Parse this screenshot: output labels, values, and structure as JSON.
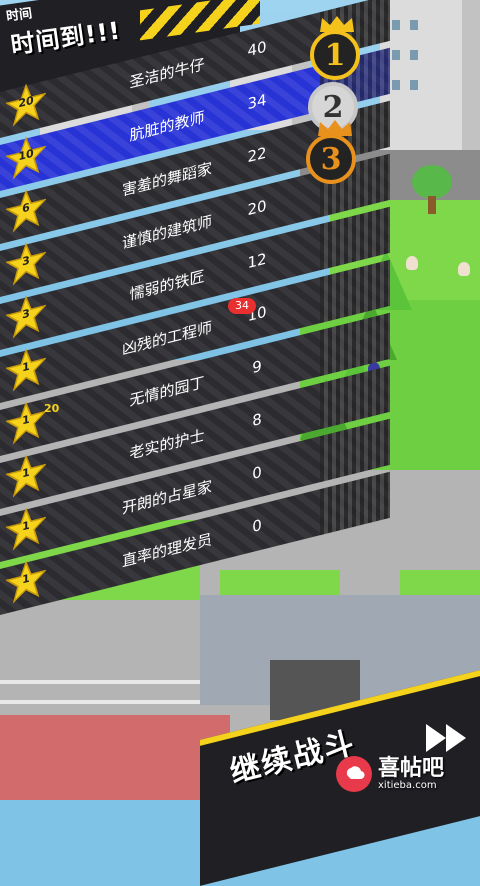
{
  "header": {
    "small_title": "时间",
    "title": "时间到!!!"
  },
  "podium": [
    {
      "rank": "1",
      "style": "gold"
    },
    {
      "rank": "2",
      "style": "silver"
    },
    {
      "rank": "3",
      "style": "bronze"
    }
  ],
  "leaderboard": [
    {
      "level": "20",
      "name": "圣洁的牛仔",
      "score": "40",
      "highlight": false
    },
    {
      "level": "10",
      "name": "肮脏的教师",
      "score": "34",
      "highlight": true
    },
    {
      "level": "6",
      "name": "害羞的舞蹈家",
      "score": "22",
      "highlight": false
    },
    {
      "level": "3",
      "name": "谨慎的建筑师",
      "score": "20",
      "highlight": false
    },
    {
      "level": "3",
      "name": "懦弱的铁匠",
      "score": "12",
      "highlight": false
    },
    {
      "level": "1",
      "name": "凶残的工程师",
      "score": "10",
      "highlight": false
    },
    {
      "level": "1",
      "name": "无情的园丁",
      "score": "9",
      "highlight": false
    },
    {
      "level": "1",
      "name": "老实的护士",
      "score": "8",
      "highlight": false
    },
    {
      "level": "1",
      "name": "开朗的占星家",
      "score": "0",
      "highlight": false
    },
    {
      "level": "1",
      "name": "直率的理发员",
      "score": "0",
      "highlight": false
    }
  ],
  "scene_labels": {
    "badge_34": "34",
    "badge_20": "20"
  },
  "footer": {
    "continue_label": "继续战斗"
  },
  "watermark": {
    "name": "喜帖吧",
    "url": "xitieba.com"
  },
  "colors": {
    "accent_yellow": "#f5d21c",
    "row_dark": "#2c2c30",
    "row_highlight": "#2833d6",
    "gold": "#f5c21c",
    "bronze": "#e8911c"
  }
}
